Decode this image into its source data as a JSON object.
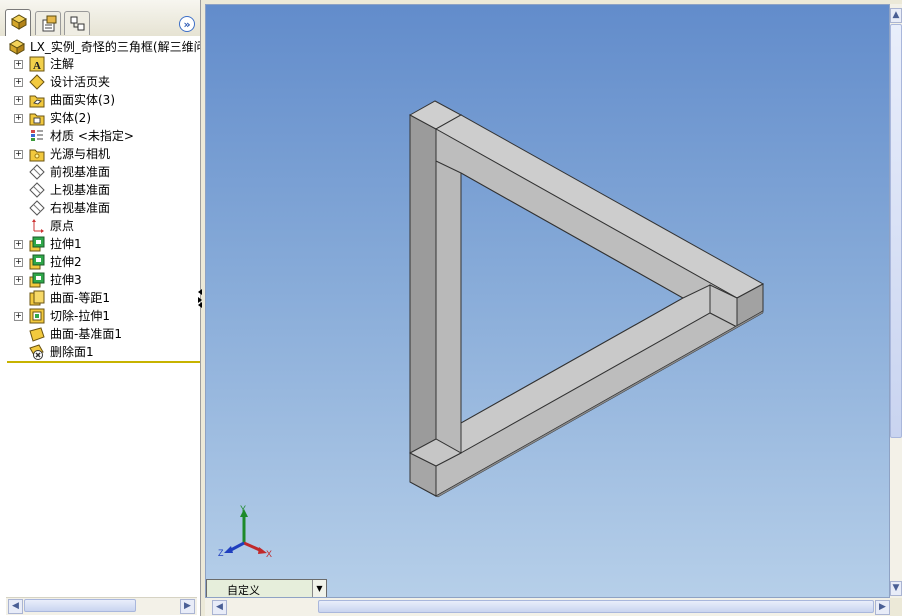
{
  "feature_tree": {
    "root": "LX_实例_奇怪的三角框(解三维问",
    "items": [
      {
        "label": "注解",
        "icon": "annotations-icon",
        "expandable": true
      },
      {
        "label": "设计活页夹",
        "icon": "design-binder-icon",
        "expandable": true
      },
      {
        "label": "曲面实体(3)",
        "icon": "surface-bodies-icon",
        "expandable": true
      },
      {
        "label": "实体(2)",
        "icon": "solid-bodies-icon",
        "expandable": true
      },
      {
        "label": "材质 <未指定>",
        "icon": "material-icon",
        "expandable": false
      },
      {
        "label": "光源与相机",
        "icon": "lights-cameras-icon",
        "expandable": true
      },
      {
        "label": "前视基准面",
        "icon": "plane-icon",
        "expandable": false
      },
      {
        "label": "上视基准面",
        "icon": "plane-icon",
        "expandable": false
      },
      {
        "label": "右视基准面",
        "icon": "plane-icon",
        "expandable": false
      },
      {
        "label": "原点",
        "icon": "origin-icon",
        "expandable": false
      },
      {
        "label": "拉伸1",
        "icon": "extrude-icon",
        "expandable": true
      },
      {
        "label": "拉伸2",
        "icon": "extrude-icon",
        "expandable": true
      },
      {
        "label": "拉伸3",
        "icon": "extrude-icon",
        "expandable": true
      },
      {
        "label": "曲面-等距1",
        "icon": "offset-surface-icon",
        "expandable": false
      },
      {
        "label": "切除-拉伸1",
        "icon": "cut-extrude-icon",
        "expandable": true
      },
      {
        "label": "曲面-基准面1",
        "icon": "planar-surface-icon",
        "expandable": false
      },
      {
        "label": "删除面1",
        "icon": "delete-face-icon",
        "expandable": false
      }
    ]
  },
  "viewport": {
    "view_orientation": "自定义",
    "triad_labels": {
      "x": "X",
      "y": "Y",
      "z": "Z"
    }
  },
  "colors": {
    "viewport_top": "#628ccb",
    "viewport_bottom": "#b6cfe9",
    "model_light": "#c8c8c8",
    "model_dark": "#9a9a9a",
    "tree_divider": "#c7b300"
  }
}
